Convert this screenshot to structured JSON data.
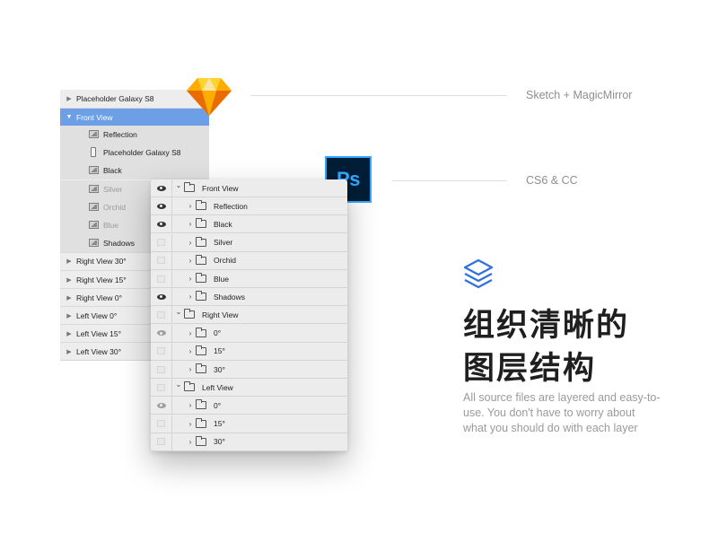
{
  "sketch_layers": [
    {
      "label": "Placeholder Galaxy S8",
      "kind": "group",
      "expanded": false
    },
    {
      "label": "Front View",
      "kind": "group",
      "expanded": true,
      "selected": true
    },
    {
      "label": "Reflection",
      "kind": "image",
      "child": true
    },
    {
      "label": "Placeholder Galaxy S8",
      "kind": "phone",
      "child": true
    },
    {
      "label": "Black",
      "kind": "image",
      "child": true
    },
    {
      "label": "Silver",
      "kind": "image",
      "child": true,
      "dim": true
    },
    {
      "label": "Orchid",
      "kind": "image",
      "child": true,
      "dim": true
    },
    {
      "label": "Blue",
      "kind": "image",
      "child": true,
      "dim": true
    },
    {
      "label": "Shadows",
      "kind": "image",
      "child": true
    },
    {
      "label": "Right View 30°",
      "kind": "group",
      "expanded": false
    },
    {
      "label": "Right View 15°",
      "kind": "group",
      "expanded": false
    },
    {
      "label": "Right View 0°",
      "kind": "group",
      "expanded": false
    },
    {
      "label": "Left View 0°",
      "kind": "group",
      "expanded": false
    },
    {
      "label": "Left View 15°",
      "kind": "group",
      "expanded": false
    },
    {
      "label": "Left View 30°",
      "kind": "group",
      "expanded": false
    }
  ],
  "ps_layers": [
    {
      "label": "Front View",
      "level": 0,
      "expanded": true,
      "visibility": "on"
    },
    {
      "label": "Reflection",
      "level": 1,
      "expanded": false,
      "visibility": "on"
    },
    {
      "label": "Black",
      "level": 1,
      "expanded": false,
      "visibility": "on"
    },
    {
      "label": "Silver",
      "level": 1,
      "expanded": false,
      "visibility": "off"
    },
    {
      "label": "Orchid",
      "level": 1,
      "expanded": false,
      "visibility": "off"
    },
    {
      "label": "Blue",
      "level": 1,
      "expanded": false,
      "visibility": "off"
    },
    {
      "label": "Shadows",
      "level": 1,
      "expanded": false,
      "visibility": "on"
    },
    {
      "label": "Right View",
      "level": 0,
      "expanded": true,
      "visibility": "off"
    },
    {
      "label": "0°",
      "level": 1,
      "expanded": false,
      "visibility": "dim"
    },
    {
      "label": "15°",
      "level": 1,
      "expanded": false,
      "visibility": "off"
    },
    {
      "label": "30°",
      "level": 1,
      "expanded": false,
      "visibility": "off"
    },
    {
      "label": "Left View",
      "level": 0,
      "expanded": true,
      "visibility": "off"
    },
    {
      "label": "0°",
      "level": 1,
      "expanded": false,
      "visibility": "dim"
    },
    {
      "label": "15°",
      "level": 1,
      "expanded": false,
      "visibility": "off"
    },
    {
      "label": "30°",
      "level": 1,
      "expanded": false,
      "visibility": "off"
    }
  ],
  "labels": {
    "sketch": "Sketch + MagicMirror",
    "ps_logo": "Ps",
    "ps": "CS6 & CC"
  },
  "headline": {
    "line1": "组织清晰的",
    "line2": "图层结构"
  },
  "description": "All source files are layered and easy-to-use. You don't have to worry about what you should do with each layer",
  "colors": {
    "sketch_selected": "#6d9fe6",
    "ps_logo_bg": "#001e36",
    "ps_logo_accent": "#31a8ff",
    "layers_icon": "#2f6fe0",
    "sketch_orange": "#f7a82a"
  },
  "icons": {
    "sketch_logo": "sketch-diamond-logo",
    "ps_logo": "photoshop-logo",
    "layers": "layers-stack-icon",
    "visibility": "eye-icon",
    "folder": "folder-icon"
  }
}
